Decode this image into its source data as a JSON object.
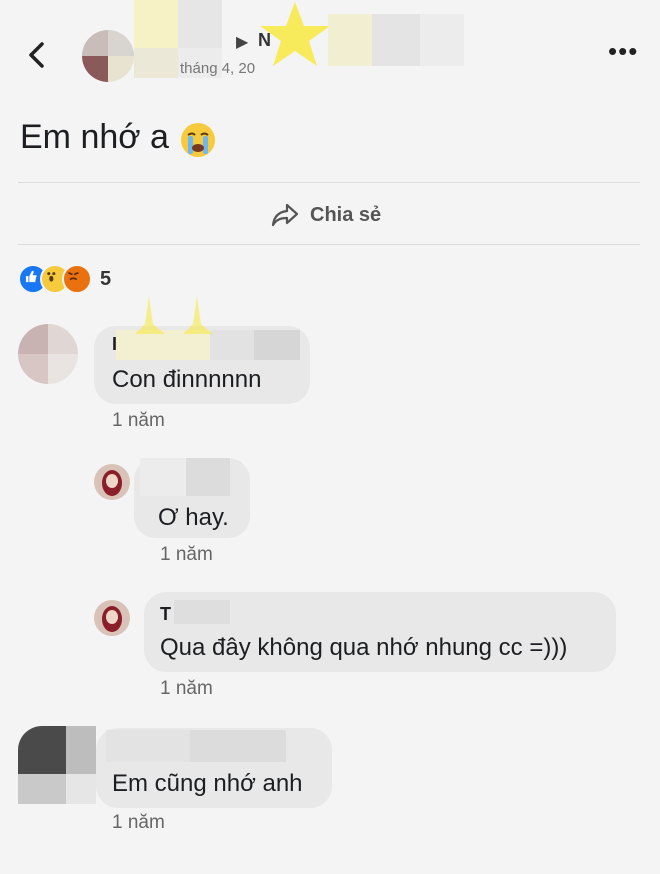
{
  "header": {
    "back_icon": "chevron-left-icon",
    "name_visible": "N",
    "date_visible": "tháng 4, 20",
    "more_icon": "more-horizontal-icon"
  },
  "post": {
    "text": "Em nhớ a",
    "emoji": "crying-face-emoji",
    "share_label": "Chia sẻ",
    "share_icon": "share-arrow-icon",
    "reaction_icons": [
      "like-icon",
      "wow-icon",
      "angry-icon"
    ],
    "reaction_count": "5"
  },
  "comments": [
    {
      "author_visible": "I",
      "text": "Con đinnnnnn",
      "time": "1 năm"
    },
    {
      "author_visible": "",
      "text": "Ơ hay.",
      "time": "1 năm",
      "reply": true
    },
    {
      "author_visible": "T",
      "text": "Qua đây không qua nhớ nhung cc =)))",
      "time": "1 năm",
      "reply": true
    },
    {
      "author_visible": "",
      "text": "Em cũng nhớ anh",
      "time": "1 năm"
    }
  ],
  "colors": {
    "background": "#f4f4f4",
    "bubble": "#e8e8e8",
    "text": "#1c1e21",
    "muted": "#666666",
    "like_blue": "#1877f2"
  }
}
